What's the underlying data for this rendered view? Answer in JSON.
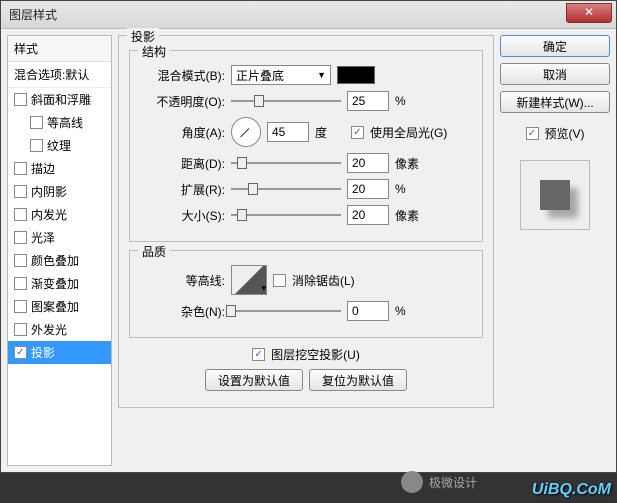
{
  "titlebar": {
    "title": "图层样式",
    "close": "✕"
  },
  "left": {
    "header": "样式",
    "sub": "混合选项:默认",
    "items": [
      {
        "label": "斜面和浮雕",
        "checked": false,
        "indent": false
      },
      {
        "label": "等高线",
        "checked": false,
        "indent": true
      },
      {
        "label": "纹理",
        "checked": false,
        "indent": true
      },
      {
        "label": "描边",
        "checked": false,
        "indent": false
      },
      {
        "label": "内阴影",
        "checked": false,
        "indent": false
      },
      {
        "label": "内发光",
        "checked": false,
        "indent": false
      },
      {
        "label": "光泽",
        "checked": false,
        "indent": false
      },
      {
        "label": "颜色叠加",
        "checked": false,
        "indent": false
      },
      {
        "label": "渐变叠加",
        "checked": false,
        "indent": false
      },
      {
        "label": "图案叠加",
        "checked": false,
        "indent": false
      },
      {
        "label": "外发光",
        "checked": false,
        "indent": false
      },
      {
        "label": "投影",
        "checked": true,
        "indent": false,
        "selected": true
      }
    ]
  },
  "center": {
    "panel_title": "投影",
    "struct": {
      "legend": "结构",
      "blend_label": "混合模式(B):",
      "blend_value": "正片叠底",
      "shadow_color": "#000000",
      "opacity_label": "不透明度(O):",
      "opacity_value": "25",
      "opacity_unit": "%",
      "angle_label": "角度(A):",
      "angle_value": "45",
      "angle_unit": "度",
      "global_light_label": "使用全局光(G)",
      "global_light_checked": true,
      "distance_label": "距离(D):",
      "distance_value": "20",
      "distance_unit": "像素",
      "spread_label": "扩展(R):",
      "spread_value": "20",
      "spread_unit": "%",
      "size_label": "大小(S):",
      "size_value": "20",
      "size_unit": "像素"
    },
    "quality": {
      "legend": "品质",
      "contour_label": "等高线:",
      "antialias_label": "消除锯齿(L)",
      "antialias_checked": false,
      "noise_label": "杂色(N):",
      "noise_value": "0",
      "noise_unit": "%"
    },
    "knockout_label": "图层挖空投影(U)",
    "knockout_checked": true,
    "set_default": "设置为默认值",
    "reset_default": "复位为默认值"
  },
  "right": {
    "ok": "确定",
    "cancel": "取消",
    "new_style": "新建样式(W)...",
    "preview_label": "预览(V)",
    "preview_checked": true
  },
  "watermark": "UiBQ.CoM",
  "wm2": "极微设计"
}
